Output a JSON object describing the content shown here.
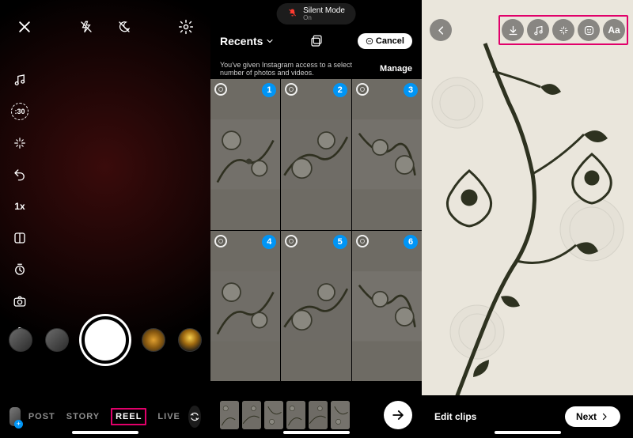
{
  "phone1": {
    "top_icons": {
      "close": "close-icon",
      "flash": "flash-off-icon",
      "moon": "night-off-icon",
      "settings": "settings-icon"
    },
    "rail": {
      "music": "music-icon",
      "limit_label": ":30",
      "effects": "sparkle-icon",
      "undo": "undo-icon",
      "speed_label": "1x",
      "layout": "layout-icon",
      "timer": "timer-icon",
      "camera": "camera-icon",
      "gesture": "hand-icon"
    },
    "modes": {
      "post": "POST",
      "story": "STORY",
      "reel": "REEL",
      "live": "LIVE"
    }
  },
  "phone2": {
    "silent_title": "Silent Mode",
    "silent_sub": "On",
    "recents_label": "Recents",
    "cancel_label": "Cancel",
    "access_msg": "You've given Instagram access to a select number of photos and videos.",
    "manage_label": "Manage",
    "selections": [
      "1",
      "2",
      "3",
      "4",
      "5",
      "6"
    ]
  },
  "phone3": {
    "tools": {
      "download": "download-icon",
      "music": "music-icon",
      "sparkle": "sparkle-icon",
      "sticker": "sticker-icon",
      "text": "text-icon"
    },
    "text_label": "Aa",
    "edit_clips": "Edit clips",
    "next": "Next"
  }
}
